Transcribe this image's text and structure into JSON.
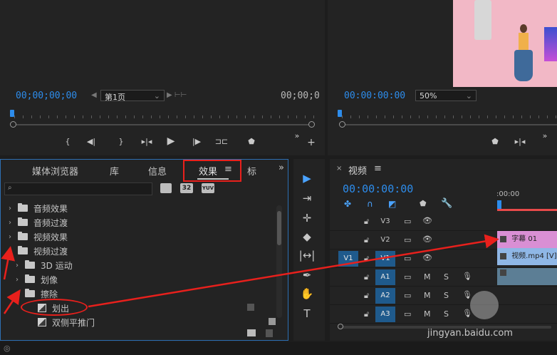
{
  "source_monitor": {
    "timecode_in": "00;00;00;00",
    "page_label": "第1页",
    "timecode_out": "00;00;0"
  },
  "program_monitor": {
    "timecode": "00:00:00:00",
    "zoom": "50%"
  },
  "effects_panel": {
    "tabs": [
      "媒体浏览器",
      "库",
      "信息",
      "效果",
      "标"
    ],
    "active_tab": "效果",
    "search_placeholder": "",
    "filter_badges": [
      "32",
      "YUV"
    ],
    "tree": [
      {
        "label": "音频效果",
        "expanded": false,
        "level": 0
      },
      {
        "label": "音频过渡",
        "expanded": false,
        "level": 0
      },
      {
        "label": "视频效果",
        "expanded": false,
        "level": 0
      },
      {
        "label": "视频过渡",
        "expanded": true,
        "level": 0
      },
      {
        "label": "3D 运动",
        "expanded": false,
        "level": 1
      },
      {
        "label": "划像",
        "expanded": false,
        "level": 1
      },
      {
        "label": "擦除",
        "expanded": true,
        "level": 1
      },
      {
        "label": "划出",
        "type": "effect",
        "level": 2
      },
      {
        "label": "双侧平推门",
        "type": "effect",
        "level": 2
      }
    ]
  },
  "timeline": {
    "title": "视频",
    "timecode": "00:00:00:00",
    "ruler_label": ":00:00",
    "tracks": [
      {
        "name": "V3",
        "kind": "video"
      },
      {
        "name": "V2",
        "kind": "video"
      },
      {
        "name": "V1",
        "kind": "video",
        "source_patch": "V1"
      },
      {
        "name": "A1",
        "kind": "audio"
      },
      {
        "name": "A2",
        "kind": "audio"
      },
      {
        "name": "A3",
        "kind": "audio"
      }
    ],
    "clips": [
      {
        "label": "字幕 01",
        "track": "V2"
      },
      {
        "label": "视频.mp4 [V]",
        "track": "V1"
      }
    ],
    "audio_buttons": {
      "mute": "M",
      "solo": "S"
    }
  },
  "watermark": "jingyan.baidu.com",
  "colors": {
    "accent": "#2d8ceb",
    "annotation": "#e8201c",
    "title_clip": "#d98fd4",
    "video_clip": "#8fb7e6"
  }
}
